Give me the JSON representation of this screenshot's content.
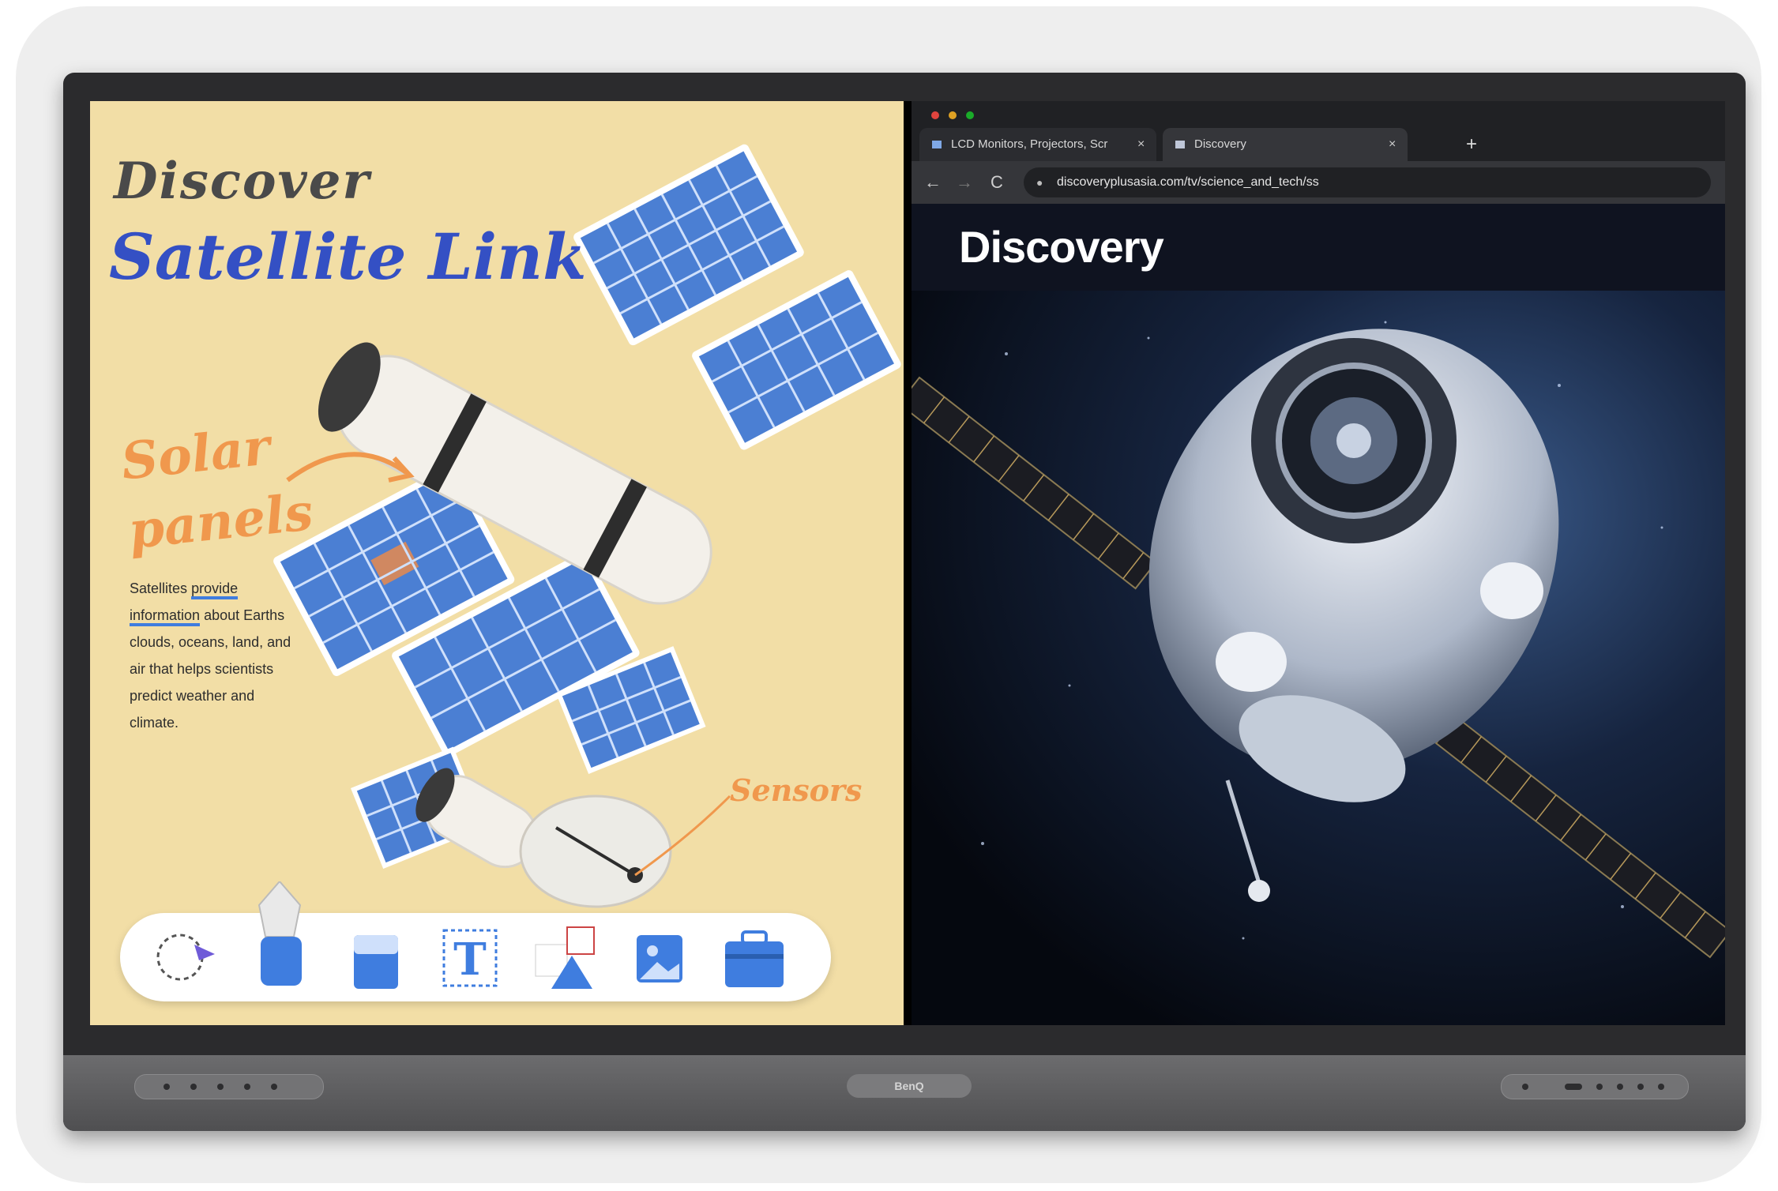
{
  "whiteboard": {
    "title_line1": "Discover",
    "title_line2": "Satellite Link",
    "annotation_solar": "Solar panels",
    "annotation_sensors": "Sensors",
    "body_pre": "Satellites",
    "body_highlight": "provide information",
    "body_post": "about Earths clouds, oceans, land, and air that helps scientists predict weather and climate.",
    "toolbar_tools": [
      "lasso-select",
      "pen",
      "eraser",
      "text",
      "shapes",
      "insert-image",
      "toolbox"
    ]
  },
  "browser": {
    "tabs": [
      {
        "label": "LCD Monitors, Projectors, Scr",
        "close": "×"
      },
      {
        "label": "Discovery",
        "close": "×"
      }
    ],
    "new_tab": "+",
    "back": "←",
    "forward": "→",
    "reload": "C",
    "url": "discoveryplusasia.com/tv/science_and_tech/ss",
    "page_logo": "Discovery"
  },
  "device": {
    "center_logo": "BenQ"
  },
  "colors": {
    "whiteboard_bg": "#f2dea6",
    "title_blue": "#3450c4",
    "annotation_orange": "#f0984d",
    "browser_bg": "#202124"
  }
}
